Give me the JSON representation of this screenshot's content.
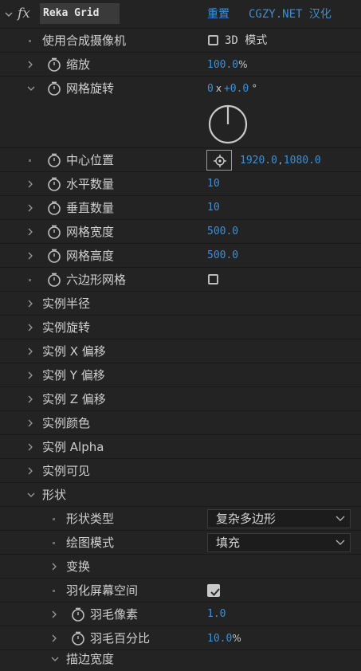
{
  "effect": {
    "icon": "fx-icon",
    "title": "Reka Grid",
    "reset_label": "重置",
    "credit": "CGZY.NET 汉化"
  },
  "rows": {
    "use_comp_camera": {
      "label": "使用合成摄像机",
      "checkbox_label": "3D 模式",
      "checked": false
    },
    "scale": {
      "label": "缩放",
      "value": "100.0",
      "unit": "%"
    },
    "grid_rotation": {
      "label": "网格旋转",
      "turns": "0",
      "x": "x",
      "degrees": "+0.0",
      "unit": "°"
    },
    "center_position": {
      "label": "中心位置",
      "x": "1920.0",
      "sep": ",",
      "y": "1080.0"
    },
    "horizontal_count": {
      "label": "水平数量",
      "value": "10"
    },
    "vertical_count": {
      "label": "垂直数量",
      "value": "10"
    },
    "grid_width": {
      "label": "网格宽度",
      "value": "500.0"
    },
    "grid_height": {
      "label": "网格高度",
      "value": "500.0"
    },
    "hex_grid": {
      "label": "六边形网格",
      "checked": false
    },
    "instance_radius": {
      "label": "实例半径"
    },
    "instance_rotation": {
      "label": "实例旋转"
    },
    "instance_x_offset": {
      "label": "实例 X 偏移"
    },
    "instance_y_offset": {
      "label": "实例 Y 偏移"
    },
    "instance_z_offset": {
      "label": "实例 Z 偏移"
    },
    "instance_color": {
      "label": "实例颜色"
    },
    "instance_alpha": {
      "label": "实例 Alpha"
    },
    "instance_visible": {
      "label": "实例可见"
    },
    "shape": {
      "label": "形状"
    },
    "shape_type": {
      "label": "形状类型",
      "selected": "复杂多边形"
    },
    "draw_mode": {
      "label": "绘图模式",
      "selected": "填充"
    },
    "transform": {
      "label": "变换"
    },
    "feather_screen_space": {
      "label": "羽化屏幕空间",
      "checked": true
    },
    "feather_pixels": {
      "label": "羽毛像素",
      "value": "1.0"
    },
    "feather_percent": {
      "label": "羽毛百分比",
      "value": "10.0",
      "unit": "%"
    },
    "stroke_width": {
      "label": "描边宽度"
    }
  },
  "colors": {
    "background": "#232323",
    "value_blue": "#3e8fd8",
    "label": "#cfcfcf"
  }
}
